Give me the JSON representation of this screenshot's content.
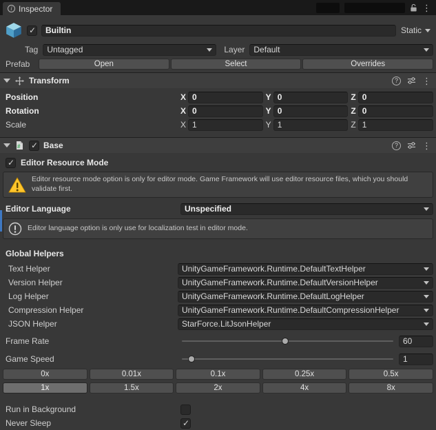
{
  "colors": {
    "background": "#383838",
    "header": "#3e3e3e",
    "field": "#2a2a2a",
    "accent_focus_blue": "#3e78c2",
    "warning_yellow": "#ffc52c"
  },
  "tabbar": {
    "tab_label": "Inspector"
  },
  "header": {
    "name": "Builtin",
    "active_checked": true,
    "static_label": "Static",
    "tag_label": "Tag",
    "tag_value": "Untagged",
    "layer_label": "Layer",
    "layer_value": "Default",
    "prefab_label": "Prefab",
    "open_label": "Open",
    "select_label": "Select",
    "overrides_label": "Overrides"
  },
  "transform": {
    "title": "Transform",
    "axes": [
      "X",
      "Y",
      "Z"
    ],
    "rows": [
      {
        "label": "Position",
        "bold": true,
        "values": [
          "0",
          "0",
          "0"
        ]
      },
      {
        "label": "Rotation",
        "bold": true,
        "values": [
          "0",
          "0",
          "0"
        ]
      },
      {
        "label": "Scale",
        "bold": false,
        "values": [
          "1",
          "1",
          "1"
        ]
      }
    ]
  },
  "base": {
    "title": "Base",
    "enabled_checked": true,
    "editor_resource_mode_label": "Editor Resource Mode",
    "editor_resource_mode_checked": true,
    "warning_text": "Editor resource mode option is only for editor mode. Game Framework will use editor resource files, which you should validate first.",
    "editor_language_label": "Editor Language",
    "editor_language_value": "Unspecified",
    "info_text": "Editor language option is only use for localization test in editor mode.",
    "global_helpers_label": "Global Helpers",
    "helpers": [
      {
        "label": "Text Helper",
        "value": "UnityGameFramework.Runtime.DefaultTextHelper"
      },
      {
        "label": "Version Helper",
        "value": "UnityGameFramework.Runtime.DefaultVersionHelper"
      },
      {
        "label": "Log Helper",
        "value": "UnityGameFramework.Runtime.DefaultLogHelper"
      },
      {
        "label": "Compression Helper",
        "value": "UnityGameFramework.Runtime.DefaultCompressionHelper"
      },
      {
        "label": "JSON Helper",
        "value": "StarForce.LitJsonHelper"
      }
    ],
    "frame_rate_label": "Frame Rate",
    "frame_rate_value": "60",
    "game_speed_label": "Game Speed",
    "game_speed_value": "1",
    "speed_row1": [
      "0x",
      "0.01x",
      "0.1x",
      "0.25x",
      "0.5x"
    ],
    "speed_row2": [
      "1x",
      "1.5x",
      "2x",
      "4x",
      "8x"
    ],
    "selected_speed": "1x",
    "run_in_background_label": "Run in Background",
    "run_in_background_checked": false,
    "never_sleep_label": "Never Sleep",
    "never_sleep_checked": true
  }
}
